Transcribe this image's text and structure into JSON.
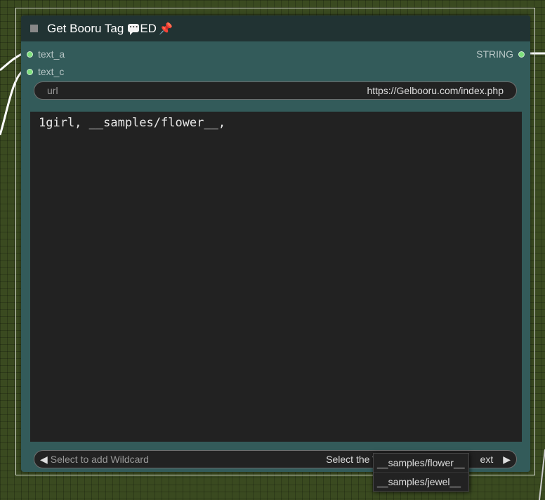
{
  "node": {
    "title": "Get Booru Tag",
    "title_suffix": "ED",
    "title_icons": [
      "speech-bubble-icon",
      "pin-icon"
    ]
  },
  "inputs": [
    {
      "name": "text_a"
    },
    {
      "name": "text_c"
    }
  ],
  "outputs": [
    {
      "name": "STRING"
    }
  ],
  "url_widget": {
    "label": "url",
    "value": "https://Gelbooru.com/index.php"
  },
  "text_area": {
    "value": "1girl, __samples/flower__,"
  },
  "wildcard_widget": {
    "label": "Select to add Wildcard",
    "value_visible": "Select the W",
    "value_tail": "ext"
  },
  "dropdown": {
    "items": [
      "__samples/flower__",
      "__samples/jewel__"
    ]
  },
  "colors": {
    "node_body": "#335b5a",
    "node_header": "#213333",
    "slot_dot": "#7de07d",
    "canvas": "#3a4a20"
  }
}
